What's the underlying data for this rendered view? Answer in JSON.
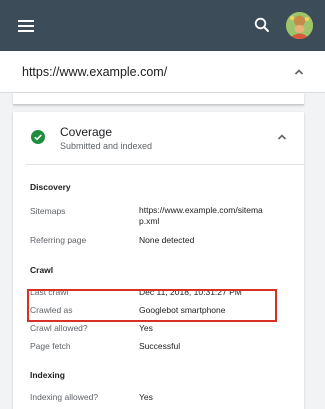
{
  "header": {
    "menu_icon": "hamburger-menu-icon",
    "search_icon": "search-icon",
    "avatar_icon": "user-avatar",
    "background": "#3c4d59"
  },
  "urlbar": {
    "url": "https://www.example.com/",
    "chevron_icon": "chevron-up-icon"
  },
  "coverage": {
    "title": "Coverage",
    "subtitle": "Submitted and indexed",
    "status_icon": "check-circle-icon",
    "status_color": "#1e8e3e",
    "chevron_icon": "chevron-up-icon"
  },
  "discovery": {
    "heading": "Discovery",
    "sitemaps_label": "Sitemaps",
    "sitemaps_value_line1": "https://www.example.com/sitema",
    "sitemaps_value_line2": "p.xml",
    "referring_label": "Referring page",
    "referring_value": "None detected"
  },
  "crawl": {
    "heading": "Crawl",
    "last_crawl_label": "Last crawl",
    "last_crawl_value": "Dec 11, 2018, 10:31:27 PM",
    "crawled_as_label": "Crawled as",
    "crawled_as_value": "Googlebot smartphone",
    "crawl_allowed_label": "Crawl allowed?",
    "crawl_allowed_value": "Yes",
    "page_fetch_label": "Page fetch",
    "page_fetch_value": "Successful"
  },
  "indexing": {
    "heading": "Indexing",
    "indexing_allowed_label": "Indexing allowed?",
    "indexing_allowed_value": "Yes"
  },
  "highlight_color": "#d93025"
}
